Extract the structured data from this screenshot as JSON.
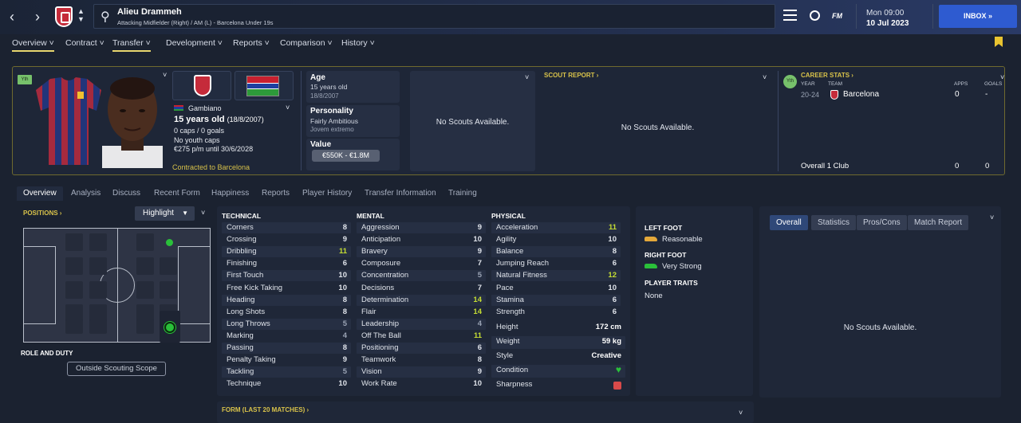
{
  "header": {
    "player_name": "Alieu Drammeh",
    "player_subtitle": "Attacking Midfielder (Right) / AM (L) - Barcelona Under 19s",
    "day": "Mon 09:00",
    "date": "10 Jul 2023",
    "inbox_label": "INBOX",
    "fm_logo": "FM"
  },
  "main_tabs": [
    "Overview",
    "Contract",
    "Transfer",
    "Development",
    "Reports",
    "Comparison",
    "History"
  ],
  "profile": {
    "yth_badge": "Yth",
    "nationality": "Gambiano",
    "age_line": "15 years old",
    "dob_paren": "(18/8/2007)",
    "caps": "0 caps / 0 goals",
    "youth_caps": "No youth caps",
    "wage": "€275 p/m until 30/6/2028",
    "contract_note": "Contracted to Barcelona"
  },
  "age_card": {
    "label": "Age",
    "value": "15 years old",
    "dob": "18/8/2007"
  },
  "personality_card": {
    "label": "Personality",
    "value": "Fairly Ambitious",
    "sub": "Jovem extremo"
  },
  "value_card": {
    "label": "Value",
    "value": "€550K - €1.8M"
  },
  "scout1": {
    "text": "No Scouts Available."
  },
  "scout_report": {
    "title": "SCOUT REPORT",
    "text": "No Scouts Available."
  },
  "career": {
    "title": "CAREER STATS",
    "badge": "Yth",
    "col_year": "YEAR",
    "col_team": "TEAM",
    "col_apps": "APPS",
    "col_goals": "GOALS",
    "year": "20-24",
    "team": "Barcelona",
    "apps": "0",
    "goals": "-",
    "overall_label": "Overall 1 Club",
    "overall_apps": "0",
    "overall_goals": "0"
  },
  "sub_tabs": [
    "Overview",
    "Analysis",
    "Discuss",
    "Recent Form",
    "Happiness",
    "Reports",
    "Player History",
    "Transfer Information",
    "Training"
  ],
  "positions": {
    "title": "POSITIONS",
    "highlight": "Highlight",
    "role_title": "ROLE AND DUTY",
    "scope_btn": "Outside Scouting Scope"
  },
  "technical": {
    "title": "TECHNICAL",
    "rows": [
      [
        "Corners",
        "8"
      ],
      [
        "Crossing",
        "9"
      ],
      [
        "Dribbling",
        "11"
      ],
      [
        "Finishing",
        "6"
      ],
      [
        "First Touch",
        "10"
      ],
      [
        "Free Kick Taking",
        "10"
      ],
      [
        "Heading",
        "8"
      ],
      [
        "Long Shots",
        "8"
      ],
      [
        "Long Throws",
        "5"
      ],
      [
        "Marking",
        "4"
      ],
      [
        "Passing",
        "8"
      ],
      [
        "Penalty Taking",
        "9"
      ],
      [
        "Tackling",
        "5"
      ],
      [
        "Technique",
        "10"
      ]
    ]
  },
  "mental": {
    "title": "MENTAL",
    "rows": [
      [
        "Aggression",
        "9"
      ],
      [
        "Anticipation",
        "10"
      ],
      [
        "Bravery",
        "9"
      ],
      [
        "Composure",
        "7"
      ],
      [
        "Concentration",
        "5"
      ],
      [
        "Decisions",
        "7"
      ],
      [
        "Determination",
        "14"
      ],
      [
        "Flair",
        "14"
      ],
      [
        "Leadership",
        "4"
      ],
      [
        "Off The Ball",
        "11"
      ],
      [
        "Positioning",
        "6"
      ],
      [
        "Teamwork",
        "8"
      ],
      [
        "Vision",
        "9"
      ],
      [
        "Work Rate",
        "10"
      ]
    ]
  },
  "physical": {
    "title": "PHYSICAL",
    "rows": [
      [
        "Acceleration",
        "11"
      ],
      [
        "Agility",
        "10"
      ],
      [
        "Balance",
        "8"
      ],
      [
        "Jumping Reach",
        "6"
      ],
      [
        "Natural Fitness",
        "12"
      ],
      [
        "Pace",
        "10"
      ],
      [
        "Stamina",
        "6"
      ],
      [
        "Strength",
        "6"
      ]
    ],
    "extra": [
      [
        "Height",
        "172 cm"
      ],
      [
        "Weight",
        "59 kg"
      ],
      [
        "Style",
        "Creative"
      ],
      [
        "Condition",
        ""
      ],
      [
        "Sharpness",
        ""
      ]
    ]
  },
  "feet": {
    "left_label": "LEFT FOOT",
    "left_value": "Reasonable",
    "right_label": "RIGHT FOOT",
    "right_value": "Very Strong",
    "traits_label": "PLAYER TRAITS",
    "traits_value": "None"
  },
  "right_tabs": [
    "Overall",
    "Statistics",
    "Pros/Cons",
    "Match Report"
  ],
  "right_panel": {
    "text": "No Scouts Available."
  },
  "form": {
    "title": "FORM (LAST 20 MATCHES)"
  },
  "colors": {
    "accent_yellow": "#d8c24a",
    "good": "#c5dd33",
    "very_good": "#2ac03a",
    "inbox": "#2e5bd0"
  }
}
